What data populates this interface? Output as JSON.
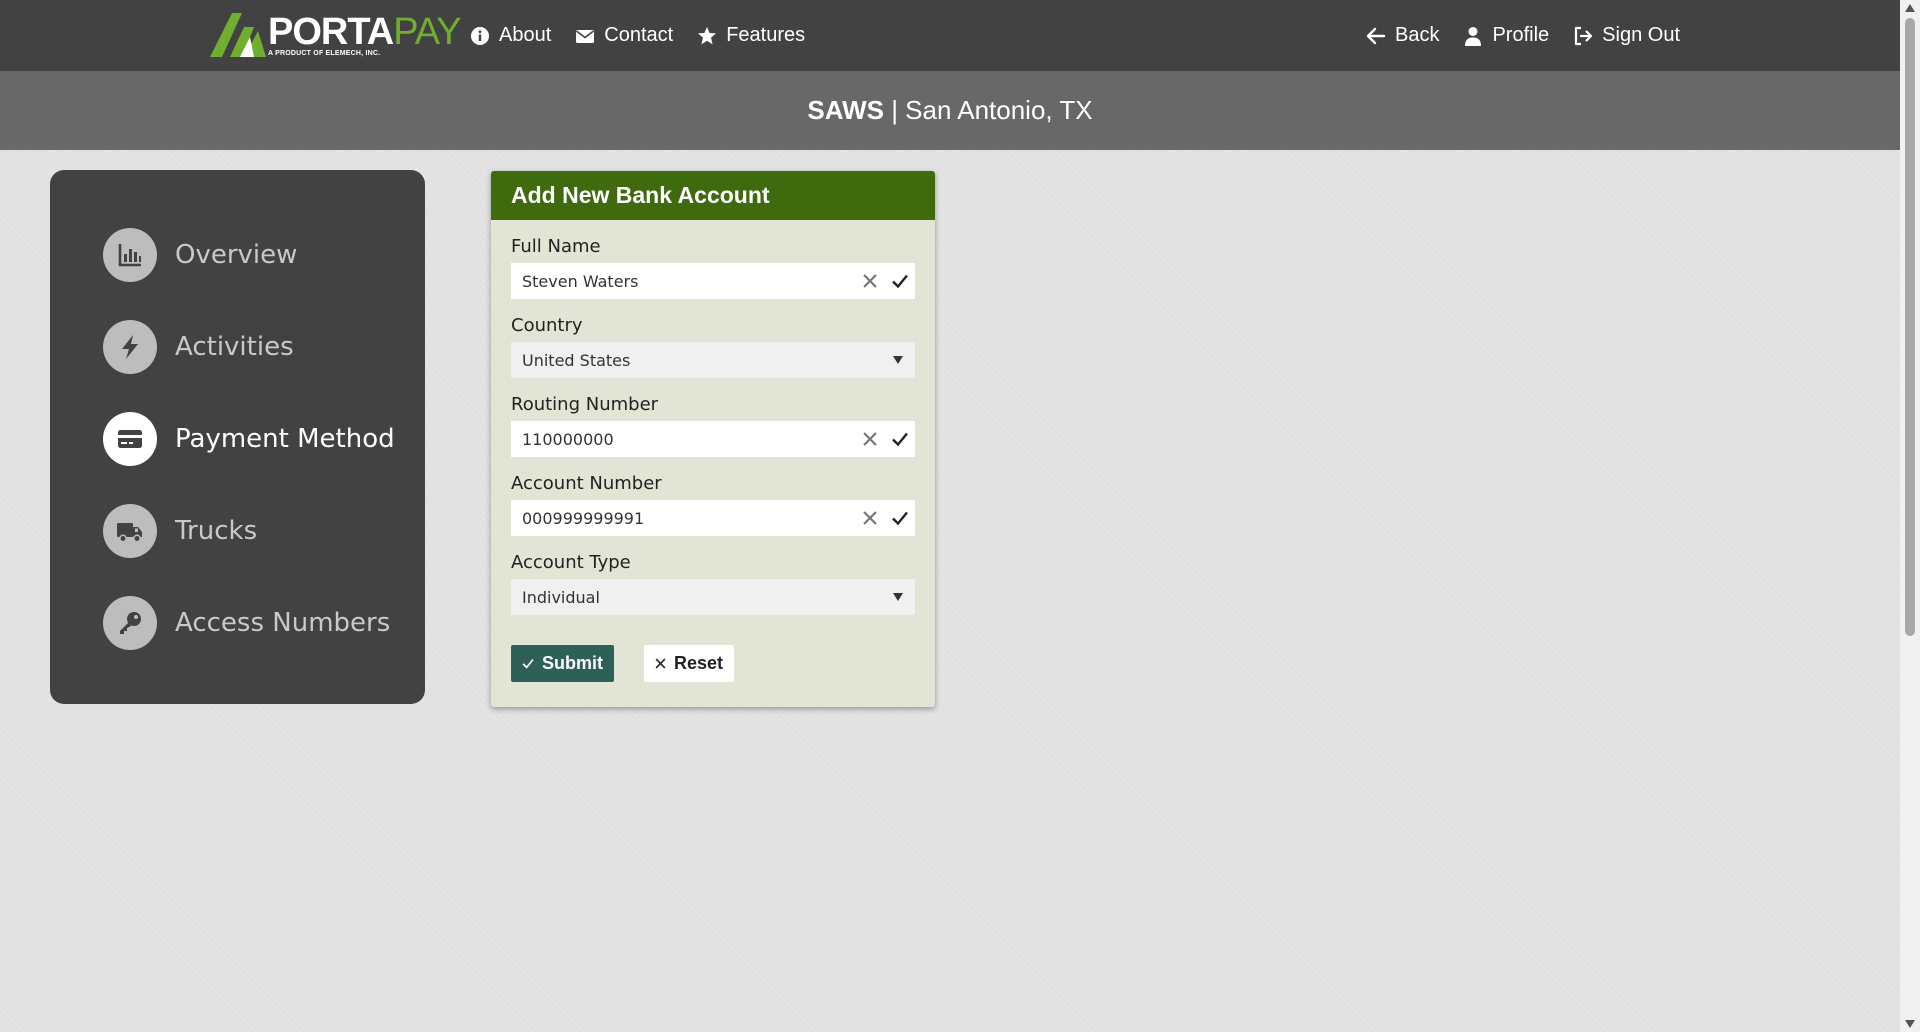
{
  "brand": {
    "name_part1": "PORTA",
    "name_part2": "PAY",
    "tagline": "A PRODUCT OF ELEMECH, INC.",
    "accent_color": "#6fae2f"
  },
  "nav": {
    "left": [
      {
        "label": "About",
        "icon": "info-icon"
      },
      {
        "label": "Contact",
        "icon": "envelope-icon"
      },
      {
        "label": "Features",
        "icon": "star-icon"
      }
    ],
    "right": [
      {
        "label": "Back",
        "icon": "arrow-left-icon"
      },
      {
        "label": "Profile",
        "icon": "user-icon"
      },
      {
        "label": "Sign Out",
        "icon": "sign-out-icon"
      }
    ]
  },
  "banner": {
    "org": "SAWS",
    "separator": " | ",
    "location": "San Antonio, TX"
  },
  "sidebar": {
    "items": [
      {
        "label": "Overview",
        "icon": "chart-icon",
        "active": false
      },
      {
        "label": "Activities",
        "icon": "bolt-icon",
        "active": false
      },
      {
        "label": "Payment Method",
        "icon": "credit-card-icon",
        "active": true
      },
      {
        "label": "Trucks",
        "icon": "truck-icon",
        "active": false
      },
      {
        "label": "Access Numbers",
        "icon": "key-icon",
        "active": false
      }
    ]
  },
  "form": {
    "title": "Add New Bank Account",
    "header_color": "#3f6a0d",
    "full_name": {
      "label": "Full Name",
      "value": "Steven Waters"
    },
    "country": {
      "label": "Country",
      "value": "United States"
    },
    "routing_number": {
      "label": "Routing Number",
      "value": "110000000"
    },
    "account_number": {
      "label": "Account Number",
      "value": "000999999991"
    },
    "account_type": {
      "label": "Account Type",
      "value": "Individual"
    },
    "submit_label": "Submit",
    "reset_label": "Reset"
  }
}
